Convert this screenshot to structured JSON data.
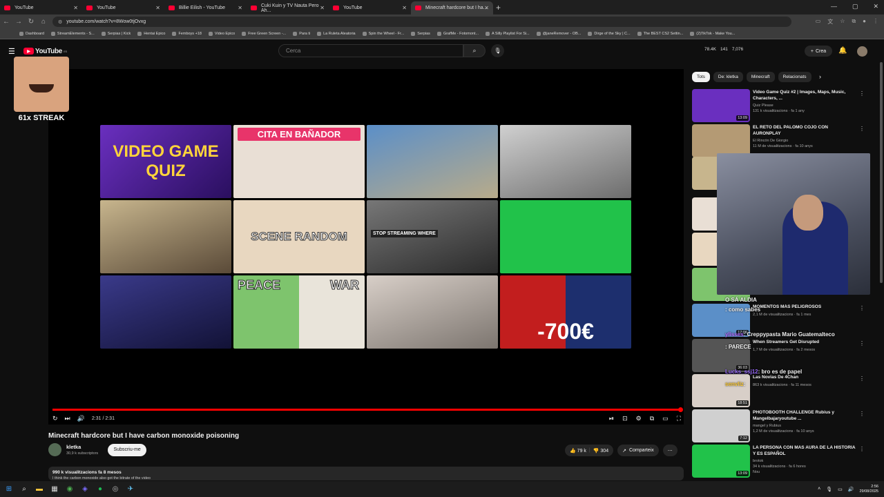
{
  "tabs": [
    {
      "title": "YouTube"
    },
    {
      "title": "YouTube"
    },
    {
      "title": "Billie Eilish - YouTube"
    },
    {
      "title": "Cuki Kuin y TV Nauta Pero Ah..."
    },
    {
      "title": "YouTube"
    },
    {
      "title": "Minecraft hardcore but I ha..."
    }
  ],
  "browser": {
    "url": "youtube.com/watch?v=8Wow0tjOvxg"
  },
  "bookmarks": [
    "Dashboard",
    "StreamElements - S...",
    "Serpias | Kick",
    "Hentai Epico",
    "Femboys +18",
    "Video Epico",
    "Free Green Screen -...",
    "Para ti",
    "La Ruleta Aleatoria",
    "Spin the Wheel - Fr...",
    "Serpias",
    "GrafMe - Fotomont...",
    "A Silly Playlist For Si...",
    "@janeRemover - OB...",
    "Dirge of the Sky | C...",
    "The BEST CS2 Settin...",
    "(2)TikTok - Make You..."
  ],
  "header": {
    "logo": "YouTube",
    "logo_region": "ES",
    "search_placeholder": "Cerca",
    "stats": [
      "78.4K",
      "141",
      "7,076"
    ],
    "create_label": "Crea"
  },
  "overlay": {
    "streak": "61x STREAK"
  },
  "endscreen": {
    "t1": "VIDEO GAME QUIZ",
    "t2": "CITA EN BAÑADOR",
    "t6": "SCENE RANDOM",
    "t7": "STOP STREAMING WHERE",
    "t10a": "PEACE",
    "t10b": "WAR",
    "t12": "-700€"
  },
  "player": {
    "time": "2:31 / 2:31",
    "progress": 1.0
  },
  "video": {
    "title": "Minecraft hardcore but I have carbon monoxide poisoning",
    "channel": "kletka",
    "subscribers": "30,9 k subscriptors",
    "subscribe_label": "Subscriu-me",
    "likes": "79 k",
    "dislikes": "304",
    "share_label": "Comparteix",
    "views": "990 k visualitzacions  fa 8 mesos",
    "desc_line": "I think the carbon monoxide also got the bitrate of the video"
  },
  "chips": [
    "Tots",
    "De: kletka",
    "Minecraft",
    "Relacionats"
  ],
  "recs": [
    {
      "title": "Video Game Quiz #2 | Images, Maps, Music, Characters, ...",
      "channel": "Quiz Please",
      "meta": "131 k visualitzacions · fa 1 any",
      "dur": "13:09",
      "color": "#6a2fbf"
    },
    {
      "title": "EL RETO DEL PALOMO COJO CON AURONPLAY",
      "channel": "El Rincón De Giorgio",
      "meta": "11 M de visualitzacions · fa 10 anys",
      "dur": "",
      "color": "#b49a74"
    },
    {
      "title": "",
      "channel": "",
      "meta": "",
      "dur": "",
      "color": "#c7b58d"
    },
    {
      "title": "",
      "channel": "",
      "meta": "",
      "dur": "",
      "color": "#e9dfd5"
    },
    {
      "title": "",
      "channel": "",
      "meta": "",
      "dur": "",
      "color": "#e8d7c0"
    },
    {
      "title": "",
      "channel": "",
      "meta": "",
      "dur": "",
      "color": "#7ec46d"
    },
    {
      "title": "MOMENTOS MÁS PELIGROSOS",
      "channel": "",
      "meta": "2,1 M de visualitzacions · fa 1 mes",
      "dur": "17:06",
      "color": "#5b8fc8"
    },
    {
      "title": "When Streamers Get Disrupted",
      "channel": "",
      "meta": "1,7 M de visualitzacions · fa 2 mesos",
      "dur": "36:03",
      "color": "#555555"
    },
    {
      "title": "Las Novias De 4Chan",
      "channel": "",
      "meta": "863 k visualitzacions · fa 11 mesos",
      "dur": "18:51",
      "color": "#d8cfc8"
    },
    {
      "title": "PHOTOBOOTH CHALLENGE Rubius y Mangelbajaryoutube ...",
      "channel": "mangel y Rubius",
      "meta": "1,2 M de visualitzacions · fa 10 anys",
      "dur": "7:12",
      "color": "#d0d0d0"
    },
    {
      "title": "LA PERSONA CON MAS AURA DE LA HISTORIA Y ES ESPAÑOL",
      "channel": "brotok",
      "meta": "34 k visualitzacions · fa 6 hores",
      "dur": "13:09",
      "color": "#21c24a"
    }
  ],
  "chat": [
    {
      "user": "",
      "text": "O SÁ ALDIA",
      "color": "#ffffff"
    },
    {
      "user": "",
      "text": ": como sabes",
      "color": "#ff4d4d"
    },
    {
      "user": "",
      "text": "",
      "color": "#ffffff"
    },
    {
      "user": "ylisses",
      "text": ": Creppypasta Mario Guatemalteco",
      "color": "#b46cff"
    },
    {
      "user": "",
      "text": ": PARECE",
      "color": "#ff4d4d"
    },
    {
      "user": "",
      "text": "",
      "color": "#ff4d4d"
    },
    {
      "user": "Lucks_ssj12",
      "text": ": bro es de papel",
      "color": "#9b6cff"
    },
    {
      "user": "senvliz",
      "text": ":",
      "color": "#ffcc33"
    }
  ],
  "rec_last_badge": "Nou",
  "clock": {
    "time": "2:56",
    "date": "29/08/2025"
  }
}
